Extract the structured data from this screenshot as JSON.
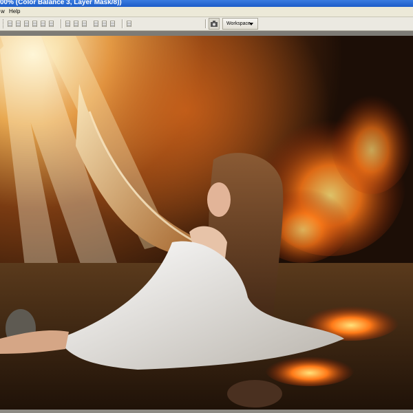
{
  "window": {
    "title": "00% (Color Balance 3, Layer Mask/8))"
  },
  "menubar": {
    "items": [
      {
        "label": "w"
      },
      {
        "label": "Help"
      }
    ]
  },
  "optionsbar": {
    "workspace_label": "Workspace",
    "align_groups": [
      {
        "icons": [
          "align-top-icon",
          "align-vcenter-icon",
          "align-bottom-icon"
        ]
      },
      {
        "icons": [
          "align-left-icon",
          "align-hcenter-icon",
          "align-right-icon"
        ]
      },
      {
        "icons": [
          "distribute-top-icon",
          "distribute-vcenter-icon",
          "distribute-bottom-icon"
        ]
      },
      {
        "icons": [
          "distribute-left-icon",
          "distribute-hcenter-icon",
          "distribute-right-icon"
        ]
      },
      {
        "icons": [
          "auto-align-icon"
        ]
      }
    ]
  },
  "canvas": {
    "description_colors": {
      "light_rays": "#fff3c8",
      "fire": "#ff6a10",
      "dress": "#f4f2ee",
      "ground": "#3a2412",
      "background_dark": "#1a0f08"
    }
  }
}
